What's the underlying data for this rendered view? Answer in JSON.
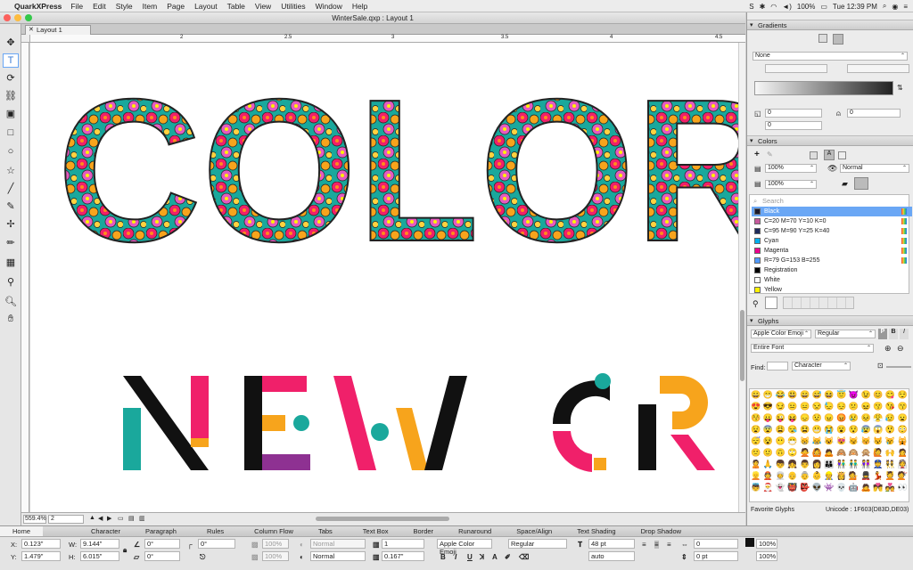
{
  "menubar": {
    "app": "QuarkXPress",
    "items": [
      "File",
      "Edit",
      "Style",
      "Item",
      "Page",
      "Layout",
      "Table",
      "View",
      "Utilities",
      "Window",
      "Help"
    ],
    "battery": "100%",
    "clock": "Tue 12:39 PM"
  },
  "window": {
    "title": "WinterSale.qxp : Layout 1",
    "tab": "Layout 1"
  },
  "rulers": {
    "h": [
      "2",
      "2.5",
      "3",
      "3.5",
      "4",
      "4.5"
    ],
    "v": []
  },
  "status": {
    "zoom": "559.4%",
    "page": "2"
  },
  "canvas": {
    "headline": "COLOR",
    "subline": "NEW CR",
    "colors": {
      "teal": "#1aa89c",
      "pink": "#f0206a",
      "orange": "#f7a41c",
      "purple": "#8e3192",
      "black": "#111111"
    }
  },
  "gradients": {
    "title": "Gradients",
    "type": "None",
    "angle1": "0",
    "angle2": "0",
    "pct1": "0",
    "pct2": "0"
  },
  "colors_panel": {
    "title": "Colors",
    "opacity1": "100%",
    "opacity2": "100%",
    "blend": "Normal",
    "search_placeholder": "Search",
    "items": [
      {
        "name": "Black",
        "swatch": "#1a1a2e"
      },
      {
        "name": "C=20 M=70 Y=10 K=0",
        "swatch": "#c75a9d"
      },
      {
        "name": "C=95 M=90 Y=25 K=40",
        "swatch": "#1f2a5a"
      },
      {
        "name": "Cyan",
        "swatch": "#00aeef"
      },
      {
        "name": "Magenta",
        "swatch": "#ec008c"
      },
      {
        "name": "R=79 G=153 B=255",
        "swatch": "#4f99ff"
      },
      {
        "name": "Registration",
        "swatch": "#000000"
      },
      {
        "name": "White",
        "swatch": "#ffffff"
      },
      {
        "name": "Yellow",
        "swatch": "#fff200"
      }
    ]
  },
  "glyphs": {
    "title": "Glyphs",
    "font": "Apple Color Emoji",
    "style": "Regular",
    "range": "Entire Font",
    "find_label": "Find:",
    "find_type": "Character",
    "favorites": "Favorite Glyphs",
    "unicode": "Unicode : 1F603(D83D,DE03)"
  },
  "measurements": {
    "tabs": [
      "Home",
      "Character",
      "Paragraph",
      "Rules",
      "Column Flow",
      "Tabs",
      "Text Box",
      "Border",
      "Runaround",
      "Space/Align",
      "Text Shading",
      "Drop Shadow"
    ],
    "x": "0.123\"",
    "y": "1.479\"",
    "w": "9.144\"",
    "h": "6.015\"",
    "angle": "0°",
    "skew": "0°",
    "corner": "0°",
    "opac1": "100%",
    "opac2": "100%",
    "blend1": "Normal",
    "blend2": "Normal",
    "cols": "1",
    "gutter": "0.167\"",
    "font": "Apple Color Emoji",
    "style": "Regular",
    "size": "48 pt",
    "leading": "auto",
    "track1": "0",
    "track2": "0 pt",
    "shade1": "100%",
    "shade2": "100%"
  }
}
